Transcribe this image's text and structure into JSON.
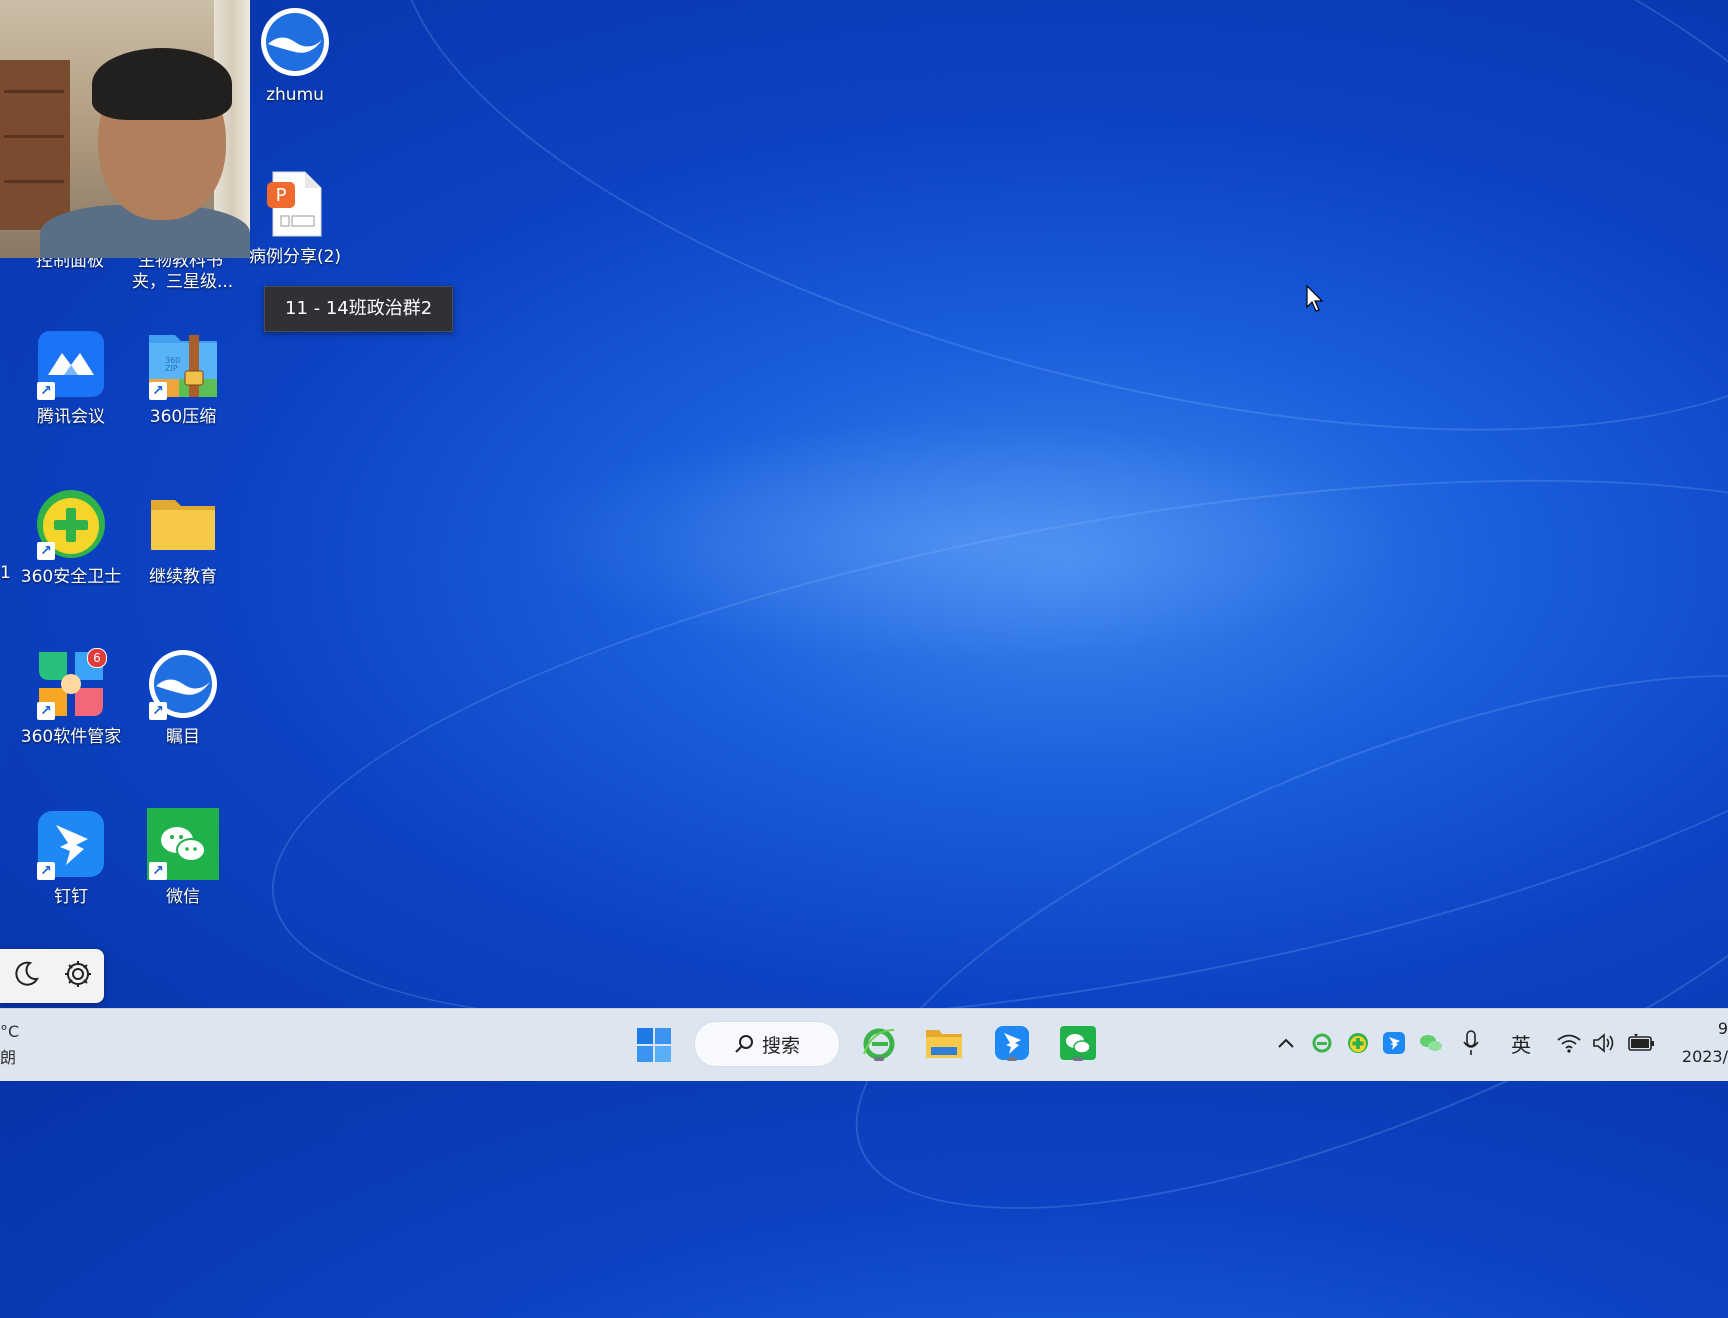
{
  "desktop": {
    "tooltip": "11 - 14班政治群2",
    "icons": [
      {
        "id": "zhumu",
        "label": "zhumu"
      },
      {
        "id": "case-share",
        "label": "病例分享(2)"
      },
      {
        "id": "tencent-meeting",
        "label": "腾讯会议"
      },
      {
        "id": "zip360",
        "label": "360压缩"
      },
      {
        "id": "safe360",
        "label": "360安全卫士"
      },
      {
        "id": "continuing-edu",
        "label": "继续教育"
      },
      {
        "id": "softmgr360",
        "label": "360软件管家",
        "badge": "6"
      },
      {
        "id": "zhumu2",
        "label": "瞩目"
      },
      {
        "id": "dingtalk",
        "label": "钉钉"
      },
      {
        "id": "wechat",
        "label": "微信"
      }
    ],
    "partial_labels": {
      "left_col_top": "控制面板",
      "mid_col_top": "三星级",
      "mid_col_top_line1": "生物教科书",
      "mid_col_top_line2": "夹，三星级...",
      "left_edge_digit": "1"
    }
  },
  "widget": {
    "moon_icon": "moon-icon",
    "gear_icon": "gear-icon"
  },
  "taskbar": {
    "search_label": "搜索",
    "left_weather_line1": "°C",
    "left_weather_line2": "朗",
    "tray_ime": "英",
    "clock_time": "9",
    "clock_date": "2023/"
  },
  "colors": {
    "accent": "#0c43c4",
    "taskbar": "#dde5f1"
  }
}
